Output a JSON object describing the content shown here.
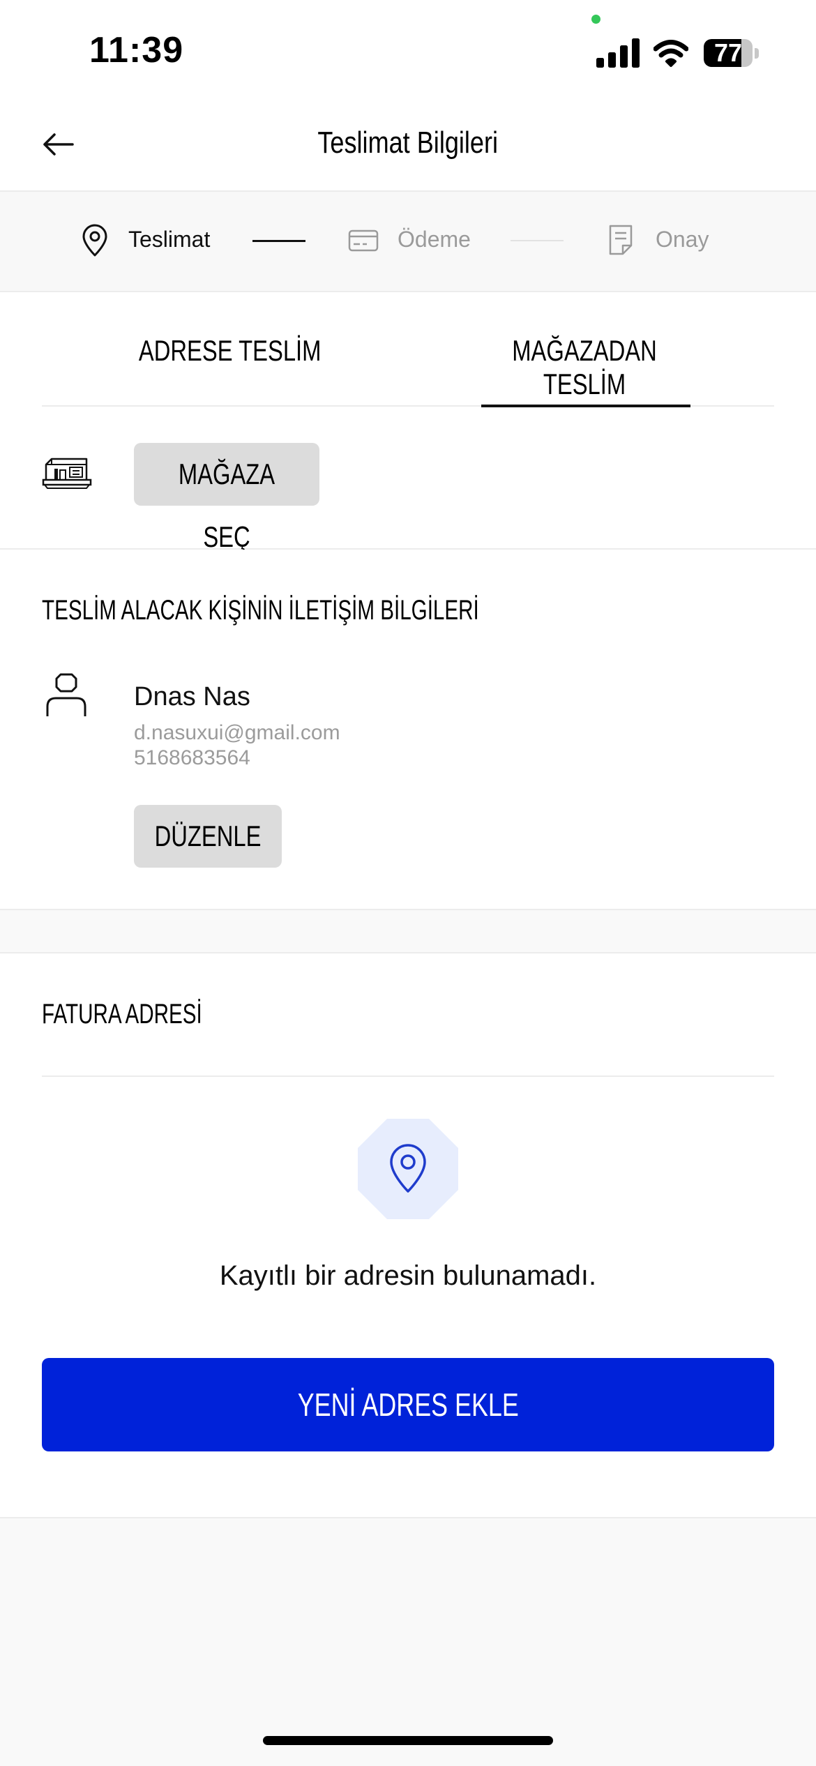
{
  "status_bar": {
    "time": "11:39",
    "battery": "77",
    "battery_level": 0.77
  },
  "header": {
    "title": "Teslimat Bilgileri"
  },
  "stepper": {
    "steps": [
      {
        "label": "Teslimat",
        "active": true
      },
      {
        "label": "Ödeme",
        "active": false
      },
      {
        "label": "Onay",
        "active": false
      }
    ]
  },
  "delivery": {
    "tabs": [
      {
        "label": "ADRESE TESLİM",
        "selected": false
      },
      {
        "label": "MAĞAZADAN TESLİM",
        "selected": true
      }
    ],
    "select_store_label": "MAĞAZA SEÇ"
  },
  "contact": {
    "title": "TESLİM ALACAK KİŞİNİN İLETİŞİM BİLGİLERİ",
    "name": "Dnas Nas",
    "email": "d.nasuxui@gmail.com",
    "phone": "5168683564",
    "edit_label": "DÜZENLE"
  },
  "billing": {
    "title": "FATURA ADRESİ",
    "empty_text": "Kayıtlı bir adresin bulunamadı.",
    "add_button_label": "YENİ ADRES EKLE"
  },
  "colors": {
    "primary": "#0022d9",
    "pin_badge_bg": "#e7edfd",
    "button_gray": "#dcdcdc",
    "inactive_text": "#9a9a9a"
  },
  "icons": [
    "back-arrow-icon",
    "location-pin-icon",
    "credit-card-icon",
    "receipt-icon",
    "store-icon",
    "person-icon"
  ]
}
